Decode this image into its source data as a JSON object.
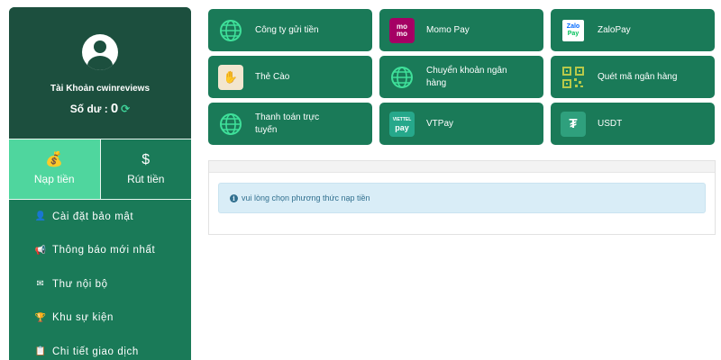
{
  "account": {
    "name_label": "Tài Khoản cwinreviews",
    "balance_label": "Số dư :",
    "balance_value": "0"
  },
  "actions": {
    "deposit": "Nạp tiền",
    "withdraw": "Rút tiền"
  },
  "menu": [
    {
      "label": "Cài đặt bảo mật",
      "icon": "user-lock-icon"
    },
    {
      "label": "Thông báo mới nhất",
      "icon": "bullhorn-icon"
    },
    {
      "label": "Thư nội bộ",
      "icon": "envelope-icon"
    },
    {
      "label": "Khu sự kiện",
      "icon": "trophy-icon"
    },
    {
      "label": "Chi tiết giao dịch",
      "icon": "clipboard-icon"
    }
  ],
  "payments": [
    {
      "label": "Công ty gửi tiền",
      "icon": "globe-icon"
    },
    {
      "label": "Momo Pay",
      "icon": "momo-logo"
    },
    {
      "label": "ZaloPay",
      "icon": "zalopay-logo"
    },
    {
      "label": "Thẻ Cào",
      "icon": "scratch-card-icon"
    },
    {
      "label": "Chuyển khoản ngân hàng",
      "icon": "globe-icon"
    },
    {
      "label": "Quét mã ngân hàng",
      "icon": "qr-code-icon"
    },
    {
      "label": "Thanh toán trực tuyến",
      "icon": "globe-icon"
    },
    {
      "label": "VTPay",
      "icon": "vtpay-logo"
    },
    {
      "label": "USDT",
      "icon": "tether-icon"
    }
  ],
  "notice": "vui lòng chọn phương thức nạp tiền",
  "colors": {
    "primary": "#1a7a58",
    "profile_bg": "#1c4f3e",
    "active": "#4fd69e",
    "notice_bg": "#d9edf7",
    "notice_text": "#31708f"
  }
}
